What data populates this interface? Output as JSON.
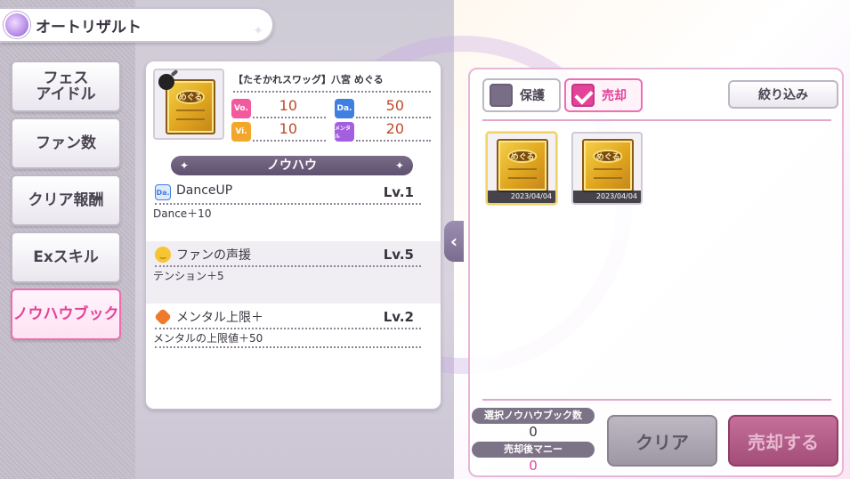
{
  "header": {
    "title": "オートリザルト"
  },
  "sidebar": {
    "items": [
      {
        "label": "フェス\nアイドル",
        "active": false
      },
      {
        "label": "ファン数",
        "active": false
      },
      {
        "label": "クリア報酬",
        "active": false
      },
      {
        "label": "Exスキル",
        "active": false
      },
      {
        "label": "ノウハウブック",
        "active": true
      }
    ]
  },
  "detail": {
    "card_name": "【たそかれスワッグ】八宮 めぐる",
    "book_badge": "めぐる",
    "stats": [
      {
        "icon_label": "Vo.",
        "value": "10",
        "color": "#f35a9e"
      },
      {
        "icon_label": "Da.",
        "value": "50",
        "color": "#3f7fe0"
      },
      {
        "icon_label": "Vi.",
        "value": "10",
        "color": "#f3a72a"
      },
      {
        "icon_label": "メンタル",
        "value": "20",
        "color": "#a35fe0"
      }
    ],
    "section_title": "ノウハウ",
    "skills": [
      {
        "icon": "dance-icon",
        "icon_label": "Da.",
        "name": "DanceUP",
        "level": "Lv.1",
        "desc": "Dance＋10"
      },
      {
        "icon": "smile-icon",
        "icon_label": "",
        "name": "ファンの声援",
        "level": "Lv.5",
        "desc": "テンション＋5"
      },
      {
        "icon": "mental-up-icon",
        "icon_label": "",
        "name": "メンタル上限＋",
        "level": "Lv.2",
        "desc": "メンタルの上限値＋50"
      }
    ]
  },
  "list": {
    "protect_label": "保護",
    "sell_label": "売却",
    "filter_label": "絞り込み",
    "items": [
      {
        "date": "2023/04/04",
        "badge": "めぐる",
        "selected": true
      },
      {
        "date": "2023/04/04",
        "badge": "めぐる",
        "selected": false
      }
    ]
  },
  "footer": {
    "selected_count_label": "選択ノウハウブック数",
    "selected_count": "0",
    "money_label": "売却後マニー",
    "money": "0",
    "clear_label": "クリア",
    "sell_label": "売却する"
  },
  "colors": {
    "accent_pink": "#e2449a",
    "panel_border": "#e8b6d6"
  }
}
